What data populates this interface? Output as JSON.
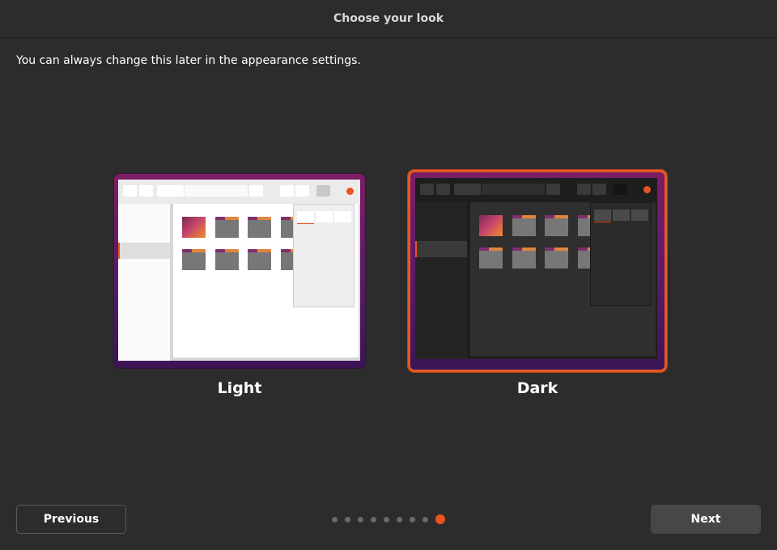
{
  "header": {
    "title": "Choose your look"
  },
  "subtitle": "You can always change this later in the appearance settings.",
  "themes": [
    {
      "label": "Light",
      "selected": false
    },
    {
      "label": "Dark",
      "selected": true
    }
  ],
  "footer": {
    "previous_label": "Previous",
    "next_label": "Next",
    "steps_total": 9,
    "current_step": 9
  },
  "colors": {
    "accent": "#e95420",
    "background": "#2c2c2c",
    "card_gradient_top": "#7d1d65",
    "card_gradient_bottom": "#3c1556"
  }
}
